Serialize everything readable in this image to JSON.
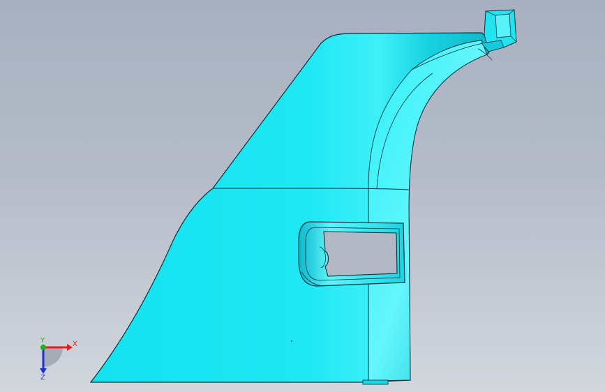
{
  "viewport": {
    "name": "cad-3d-viewport",
    "background_top": "#a8b0c0",
    "background_bottom": "#d2d6dd"
  },
  "part": {
    "name": "cyan-trim-panel",
    "fill_color": "#1fe6f2",
    "highlight_color": "#5cf4fb",
    "edge_color": "#0b2f3a"
  },
  "triad": {
    "x_label": "X",
    "y_label": "Y",
    "z_label": "Z",
    "x_color": "#e02020",
    "y_color": "#20b020",
    "z_color": "#2030d0"
  }
}
